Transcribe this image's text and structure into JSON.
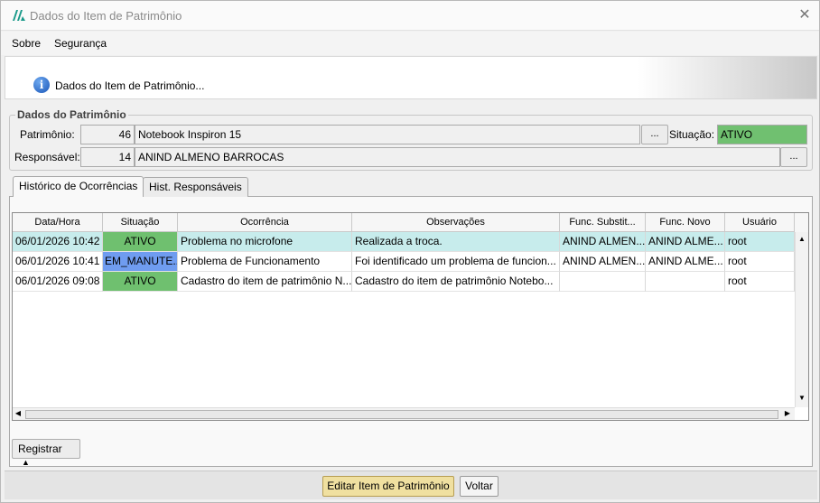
{
  "window": {
    "title": "Dados do Item de Patrimônio"
  },
  "menu": {
    "items": [
      "Sobre",
      "Segurança"
    ]
  },
  "banner": {
    "text": "Dados do Item de Patrimônio..."
  },
  "patrimonio_group": {
    "legend": "Dados do Patrimônio",
    "patrimonio_label": "Patrimônio:",
    "patrimonio_id": "46",
    "patrimonio_desc": "Notebook Inspiron 15",
    "lookup_label": "...",
    "situacao_label": "Situação:",
    "situacao_value": "ATIVO",
    "responsavel_label": "Responsável:",
    "responsavel_id": "14",
    "responsavel_nome": "ANIND ALMENO BARROCAS",
    "colors": {
      "ativo": "#70c070"
    }
  },
  "tabs": [
    {
      "label": "Histórico de Ocorrências",
      "active": true
    },
    {
      "label": "Hist. Responsáveis",
      "active": false
    }
  ],
  "grid": {
    "columns": [
      "Data/Hora",
      "Situação",
      "Ocorrência",
      "Observações",
      "Func. Substit...",
      "Func. Novo",
      "Usuário"
    ],
    "rows": [
      {
        "data_hora": "06/01/2026 10:42",
        "situacao": "ATIVO",
        "ocorrencia": "Problema no microfone",
        "observacoes": "Realizada a troca.",
        "func_subst": "ANIND ALMEN...",
        "func_novo": "ANIND ALME...",
        "usuario": "root"
      },
      {
        "data_hora": "06/01/2026 10:41",
        "situacao": "EM_MANUTE...",
        "ocorrencia": "Problema de Funcionamento",
        "observacoes": "Foi identificado um problema de funcion...",
        "func_subst": "ANIND ALMEN...",
        "func_novo": "ANIND ALME...",
        "usuario": "root"
      },
      {
        "data_hora": "06/01/2026 09:08",
        "situacao": "ATIVO",
        "ocorrencia": "Cadastro do item de patrimônio N...",
        "observacoes": "Cadastro do item de patrimônio Notebo...",
        "func_subst": "",
        "func_novo": "",
        "usuario": "root"
      }
    ],
    "colors": {
      "ativo": "#6fc06f",
      "em_manutencao": "#6f9cf0",
      "selected_row": "#c7ecec"
    }
  },
  "registrar_button": {
    "label": "Registrar"
  },
  "footer": {
    "edit_label": "Editar Item de Patrimônio",
    "back_label": "Voltar"
  }
}
